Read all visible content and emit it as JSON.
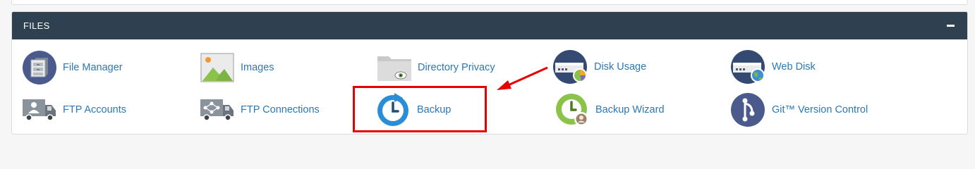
{
  "panel": {
    "title": "FILES",
    "collapse_icon": "minus-icon"
  },
  "items": [
    {
      "label": "File Manager",
      "icon": "file-manager-icon"
    },
    {
      "label": "Images",
      "icon": "images-icon"
    },
    {
      "label": "Directory Privacy",
      "icon": "directory-privacy-icon"
    },
    {
      "label": "Disk Usage",
      "icon": "disk-usage-icon"
    },
    {
      "label": "Web Disk",
      "icon": "web-disk-icon"
    },
    {
      "label": "FTP Accounts",
      "icon": "ftp-accounts-icon"
    },
    {
      "label": "FTP Connections",
      "icon": "ftp-connections-icon"
    },
    {
      "label": "Backup",
      "icon": "backup-icon"
    },
    {
      "label": "Backup Wizard",
      "icon": "backup-wizard-icon"
    },
    {
      "label": "Git™ Version Control",
      "icon": "git-version-control-icon"
    }
  ],
  "annotation": {
    "highlighted_item": "Backup",
    "color": "#e60000"
  },
  "colors": {
    "header_bg": "#2f4050",
    "link": "#2b78b6"
  }
}
